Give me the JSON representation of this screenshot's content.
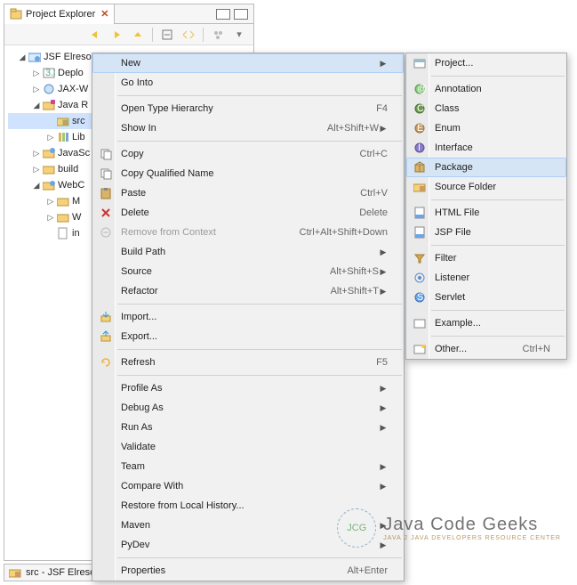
{
  "view": {
    "title": "Project Explorer"
  },
  "tree": {
    "root": "JSF Elresol",
    "nodes": {
      "deplo": "Deplo",
      "jaxw": "JAX-W",
      "javar": "Java R",
      "src": "src",
      "lib": "Lib",
      "javasc": "JavaSc",
      "build": "build",
      "webc": "WebC",
      "m": "M",
      "w": "W",
      "in": "in"
    }
  },
  "context_menu": {
    "new": "New",
    "go_into": "Go Into",
    "open_type_hierarchy": {
      "label": "Open Type Hierarchy",
      "accel": "F4"
    },
    "show_in": {
      "label": "Show In",
      "accel": "Alt+Shift+W"
    },
    "copy": {
      "label": "Copy",
      "accel": "Ctrl+C"
    },
    "copy_qualified": "Copy Qualified Name",
    "paste": {
      "label": "Paste",
      "accel": "Ctrl+V"
    },
    "delete": {
      "label": "Delete",
      "accel": "Delete"
    },
    "remove_context": {
      "label": "Remove from Context",
      "accel": "Ctrl+Alt+Shift+Down"
    },
    "build_path": "Build Path",
    "source": {
      "label": "Source",
      "accel": "Alt+Shift+S"
    },
    "refactor": {
      "label": "Refactor",
      "accel": "Alt+Shift+T"
    },
    "import": "Import...",
    "export": "Export...",
    "refresh": {
      "label": "Refresh",
      "accel": "F5"
    },
    "profile_as": "Profile As",
    "debug_as": "Debug As",
    "run_as": "Run As",
    "validate": "Validate",
    "team": "Team",
    "compare_with": "Compare With",
    "restore_history": "Restore from Local History...",
    "maven": "Maven",
    "pydev": "PyDev",
    "properties": {
      "label": "Properties",
      "accel": "Alt+Enter"
    }
  },
  "new_submenu": {
    "project": "Project...",
    "annotation": "Annotation",
    "class": "Class",
    "enum": "Enum",
    "interface": "Interface",
    "package": "Package",
    "source_folder": "Source Folder",
    "html_file": "HTML File",
    "jsp_file": "JSP File",
    "filter": "Filter",
    "listener": "Listener",
    "servlet": "Servlet",
    "example": "Example...",
    "other": {
      "label": "Other...",
      "accel": "Ctrl+N"
    }
  },
  "statusbar": {
    "label": "src - JSF Elresolv"
  },
  "watermark": {
    "line1": "Java Code Geeks",
    "line2": "JAVA 2 JAVA DEVELOPERS RESOURCE CENTER",
    "badge": "JCG"
  }
}
